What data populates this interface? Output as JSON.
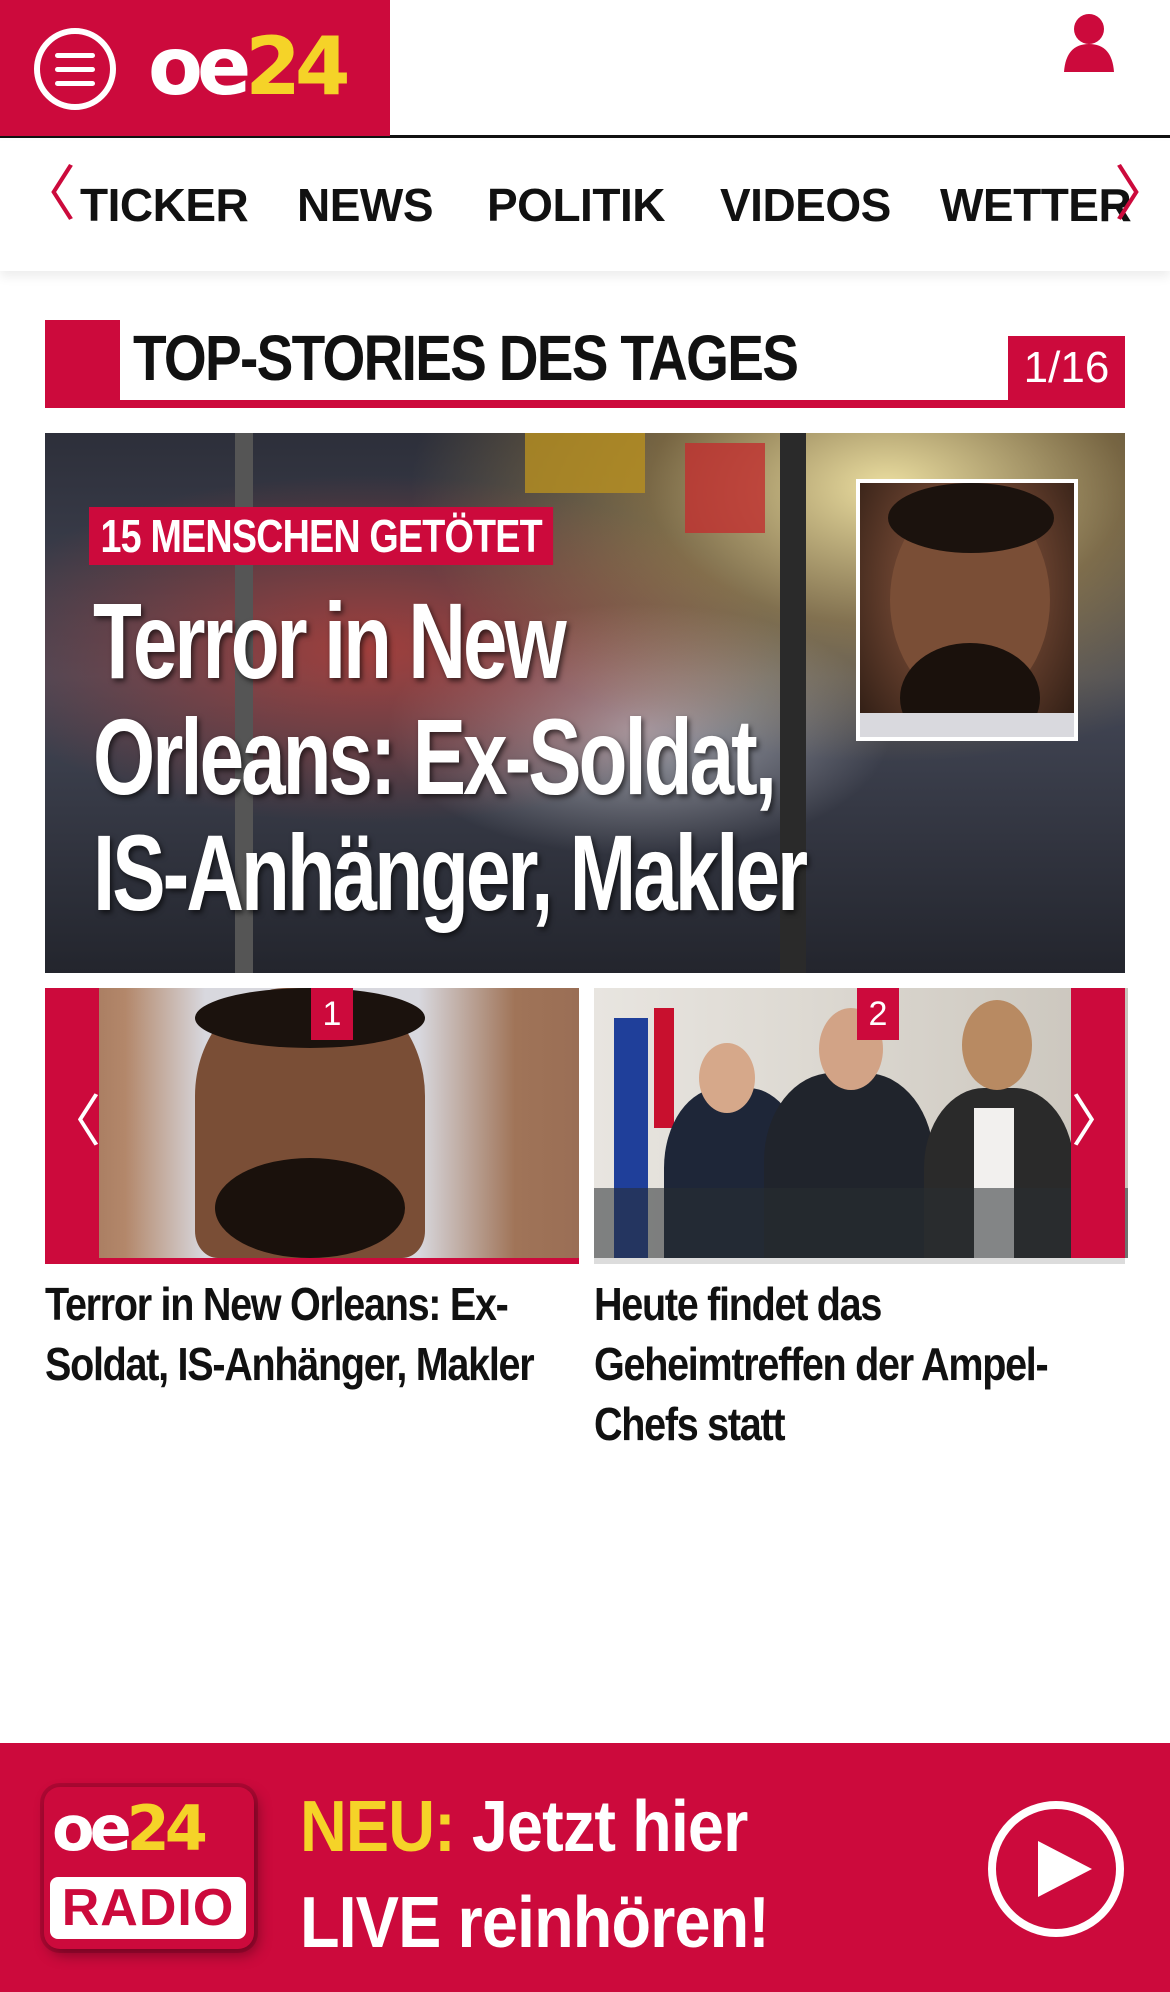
{
  "header": {
    "logo_oe": "oe",
    "logo_num": "24",
    "menu_icon": "hamburger-menu-icon",
    "user_icon": "user-icon",
    "brand_color": "#cc0a3c",
    "logo_accent_color": "#f5d328"
  },
  "nav": {
    "items": [
      {
        "label": "TICKER"
      },
      {
        "label": "NEWS"
      },
      {
        "label": "POLITIK"
      },
      {
        "label": "VIDEOS"
      },
      {
        "label": "WETTER"
      }
    ],
    "prev_glyph": "〈",
    "next_glyph": "〉"
  },
  "top_stories": {
    "title": "TOP-STORIES DES TAGES",
    "counter": "1/16",
    "hero": {
      "kicker": "15 MENSCHEN GETÖTET",
      "headline_line1": "Terror in New",
      "headline_line2": "Orleans: Ex-Soldat,",
      "headline_line3": "IS-Anhänger, Makler"
    },
    "carousel": {
      "prev_glyph": "〈",
      "next_glyph": "〉",
      "items": [
        {
          "badge": "1",
          "title": "Terror in New Orleans: Ex-Soldat, IS-Anhänger, Makler"
        },
        {
          "badge": "2",
          "title": "Heute findet das Geheimtreffen der Ampel-Chefs statt"
        }
      ]
    }
  },
  "radio_banner": {
    "logo_oe": "oe",
    "logo_num": "24",
    "logo_radio": "RADIO",
    "neu": "NEU:",
    "line1_rest": " Jetzt hier",
    "line2": "LIVE reinhören!",
    "play_icon": "play-icon"
  }
}
